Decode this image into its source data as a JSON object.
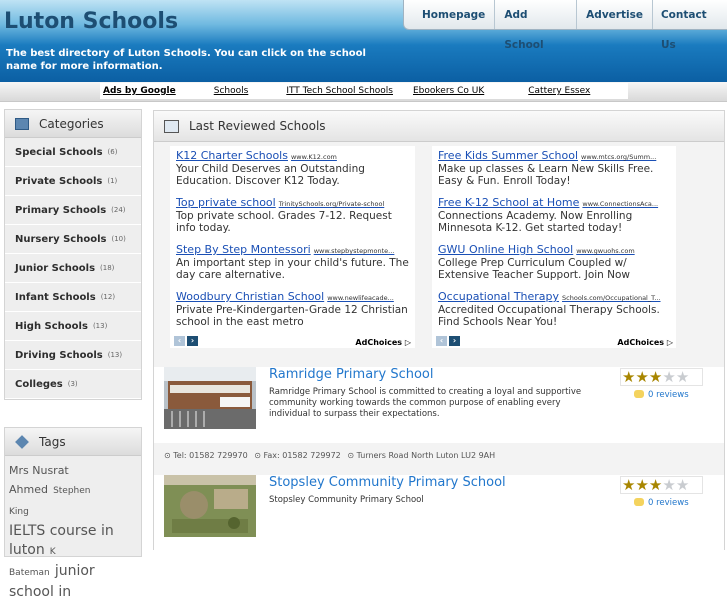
{
  "site": {
    "title": "Luton Schools",
    "description": "The best directory of Luton Schools. You can click on the school name for more information."
  },
  "nav": [
    "Homepage",
    "Add School",
    "Advertise",
    "Contact Us"
  ],
  "adbar": [
    "Ads by Google",
    "Schools",
    "ITT Tech School Schools",
    "Ebookers Co UK",
    "Cattery Essex"
  ],
  "categories": {
    "title": "Categories",
    "items": [
      {
        "name": "Special Schools",
        "count": "(6)"
      },
      {
        "name": "Private Schools",
        "count": "(1)"
      },
      {
        "name": "Primary Schools",
        "count": "(24)"
      },
      {
        "name": "Nursery Schools",
        "count": "(10)"
      },
      {
        "name": "Junior Schools",
        "count": "(18)"
      },
      {
        "name": "Infant Schools",
        "count": "(12)"
      },
      {
        "name": "High Schools",
        "count": "(13)"
      },
      {
        "name": "Driving Schools",
        "count": "(13)"
      },
      {
        "name": "Colleges",
        "count": "(3)"
      }
    ]
  },
  "tags": {
    "title": "Tags",
    "items": [
      "Mrs Nusrat",
      "Ahmed",
      "Stephen",
      "King",
      "IELTS course in",
      "luton",
      "K",
      "Bateman",
      "junior",
      "school in"
    ]
  },
  "main": {
    "title": "Last Reviewed Schools"
  },
  "ads_left": [
    {
      "title": "K12 Charter Schools",
      "url": "www.K12.com",
      "desc": "Your Child Deserves an Outstanding Education. Discover K12 Today."
    },
    {
      "title": "Top private school",
      "url": "TrinitySchools.org/Private-school",
      "desc": "Top private school. Grades 7-12. Request info today."
    },
    {
      "title": "Step By Step Montessori",
      "url": "www.stepbystepmonte...",
      "desc": "An important step in your child's future. The day care alternative."
    },
    {
      "title": "Woodbury Christian School",
      "url": "www.newlifeacade...",
      "desc": "Private Pre-Kindergarten-Grade 12 Christian school in the east metro"
    }
  ],
  "ads_right": [
    {
      "title": "Free Kids Summer School",
      "url": "www.mtcs.org/Summ...",
      "desc": "Make up classes & Learn New Skills Free. Easy & Fun. Enroll Today!"
    },
    {
      "title": "Free K-12 School at Home",
      "url": "www.ConnectionsAca...",
      "desc": "Connections Academy. Now Enrolling Minnesota K-12. Get started today!"
    },
    {
      "title": "GWU Online High School",
      "url": "www.gwuohs.com",
      "desc": "College Prep Curriculum Coupled w/ Extensive Teacher Support. Join Now"
    },
    {
      "title": "Occupational Therapy",
      "url": "Schools.com/Occupational_T...",
      "desc": "Accredited Occupational Therapy Schools. Find Schools Near You!"
    }
  ],
  "adchoices": "AdChoices",
  "schools": [
    {
      "name": "Ramridge Primary School",
      "desc": "Ramridge Primary School is committed to creating a loyal and supportive community working towards the common purpose of enabling every individual to surpass their expectations.",
      "rating": 3,
      "reviews": "0 reviews",
      "tel": "Tel: 01582 729970",
      "fax": "Fax: 01582 729972",
      "address": "Turners Road North Luton LU2 9AH"
    },
    {
      "name": "Stopsley Community Primary School",
      "desc": "Stopsley Community Primary School",
      "rating": 3,
      "reviews": "0 reviews"
    }
  ]
}
